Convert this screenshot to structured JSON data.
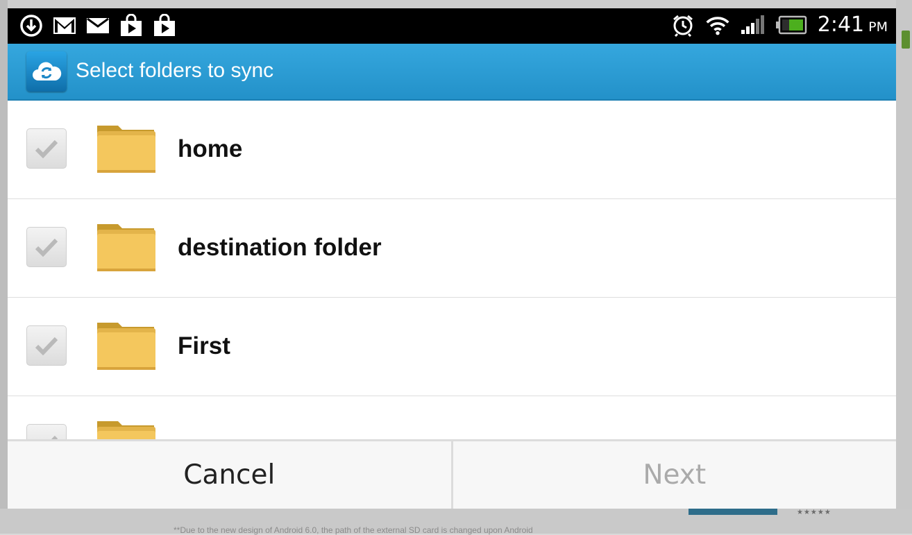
{
  "status_bar": {
    "time": "2:41",
    "ampm": "PM",
    "left_icons": [
      "download-icon",
      "gmail-icon",
      "email-icon",
      "play-store-icon",
      "play-icon"
    ],
    "right_icons": [
      "alarm-icon",
      "wifi-icon",
      "signal-icon",
      "battery-icon"
    ]
  },
  "dialog": {
    "title": "Select folders to sync",
    "app_icon": "cloud-sync-icon",
    "folders": [
      {
        "label": "home",
        "checked": true
      },
      {
        "label": "destination folder",
        "checked": true
      },
      {
        "label": "First",
        "checked": true
      },
      {
        "label": "",
        "checked": true
      }
    ],
    "cancel_label": "Cancel",
    "next_label": "Next"
  },
  "background": {
    "note": "**Due to the new design of Android 6.0, the path of the external SD card is changed upon Android",
    "rating_stars": "★★★★★"
  },
  "colors": {
    "accent": "#2a9fd8",
    "status_bar": "#000000",
    "folder": "#f2c14e",
    "disabled_text": "#aaaaaa"
  }
}
